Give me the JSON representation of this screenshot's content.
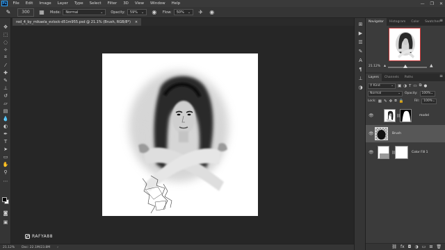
{
  "menu": {
    "logo": "Ps",
    "items": [
      "File",
      "Edit",
      "Image",
      "Layer",
      "Type",
      "Select",
      "Filter",
      "3D",
      "View",
      "Window",
      "Help"
    ],
    "window_controls": [
      "—",
      "❐",
      "✕"
    ]
  },
  "options": {
    "brush_size": "300",
    "mode_label": "Mode:",
    "mode_value": "Normal",
    "opacity_label": "Opacity:",
    "opacity_value": "59%",
    "flow_label": "Flow:",
    "flow_value": "50%"
  },
  "document": {
    "tab_title": "red_4_by_mikaela_evlock-d51m955.psd @ 21.1% (Brush, RGB/8*)",
    "close": "×"
  },
  "status": {
    "zoom": "21.12%",
    "doc_size": "Doc: 22.1M/23.8M"
  },
  "watermark": "RAFYA88",
  "navigator": {
    "tabs": [
      "Navigator",
      "Histogram",
      "Color",
      "Swatches"
    ],
    "zoom": "21.12%"
  },
  "layers": {
    "tabs": [
      "Layers",
      "Channels",
      "Paths"
    ],
    "filter_kind": "Kind",
    "blend_mode": "Normal",
    "opacity_label": "Opacity:",
    "opacity_value": "100%",
    "lock_label": "Lock:",
    "fill_label": "Fill:",
    "fill_value": "100%",
    "items": [
      {
        "name": "model"
      },
      {
        "name": "Brush"
      },
      {
        "name": "Color Fill 1"
      }
    ]
  }
}
